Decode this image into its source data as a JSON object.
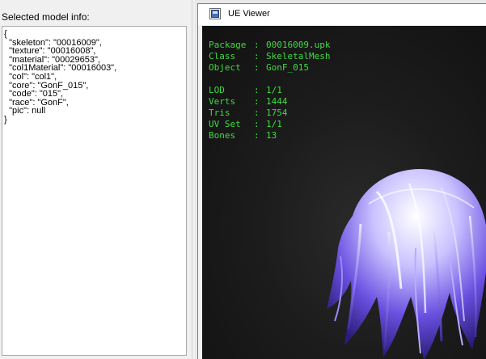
{
  "left_panel": {
    "label": "Selected model info:",
    "info_lines": [
      "{",
      "  \"skeleton\": \"00016009\",",
      "  \"texture\": \"00016008\",",
      "  \"material\": \"00029653\",",
      "  \"col1Material\": \"00016003\",",
      "  \"col\": \"col1\",",
      "  \"core\": \"GonF_015\",",
      "  \"code\": \"015\",",
      "  \"race\": \"GonF\",",
      "  \"pic\": null",
      "}"
    ]
  },
  "viewer": {
    "title": "UE Viewer",
    "info": {
      "package_label": "Package",
      "package": "00016009.upk",
      "class_label": "Class",
      "class": "SkeletalMesh",
      "object_label": "Object",
      "object": "GonF_015",
      "lod_label": "LOD",
      "lod": "1/1",
      "verts_label": "Verts",
      "verts": "1444",
      "tris_label": "Tris",
      "tris": "1754",
      "uvset_label": "UV Set",
      "uvset": "1/1",
      "bones_label": "Bones",
      "bones": "13"
    },
    "text_color": "#3fdc3f",
    "mesh_colors": [
      "#6a4fe0",
      "#c9c2ff",
      "#ffffff",
      "#3b2a9a"
    ]
  }
}
